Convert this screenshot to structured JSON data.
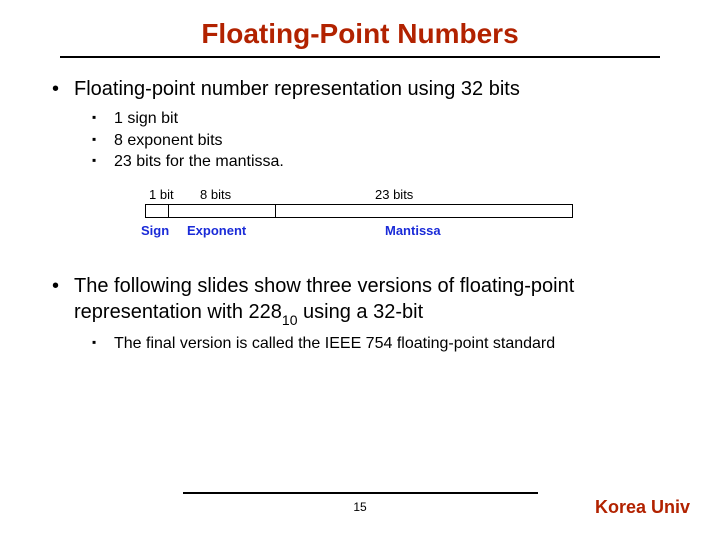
{
  "title": "Floating-Point Numbers",
  "bullets": {
    "main1": "Floating-point number representation using 32 bits",
    "sub1": {
      "a": "1 sign bit",
      "b": "8 exponent bits",
      "c": "23 bits for the mantissa."
    },
    "main2_a": "The following slides show three versions of floating-point representation with 228",
    "main2_sub": "10",
    "main2_b": " using a 32-bit",
    "sub2": {
      "a": "The final version is called the IEEE 754 floating-point standard"
    }
  },
  "diagram": {
    "top_labels": {
      "sign": "1 bit",
      "exp": "8 bits",
      "mant": "23 bits"
    },
    "bottom_labels": {
      "sign": "Sign",
      "exp": "Exponent",
      "mant": "Mantissa"
    }
  },
  "page_number": "15",
  "org": "Korea Univ"
}
